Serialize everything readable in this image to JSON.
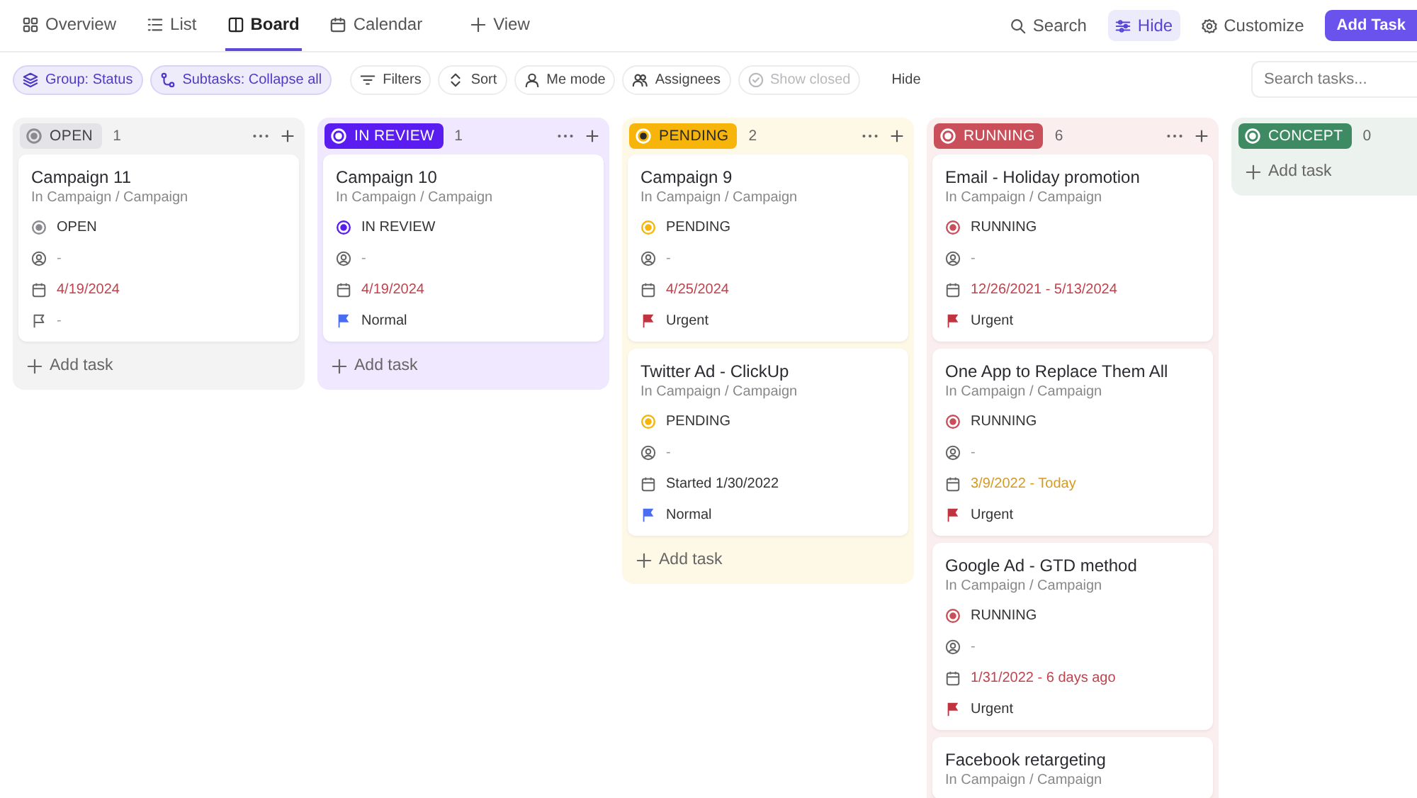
{
  "views": [
    {
      "label": "Overview",
      "selected": false
    },
    {
      "label": "List",
      "selected": false
    },
    {
      "label": "Board",
      "selected": true
    },
    {
      "label": "Calendar",
      "selected": false
    },
    {
      "label": "View",
      "selected": false
    }
  ],
  "header_actions": [
    {
      "label": "Search",
      "selected": false
    },
    {
      "label": "Hide",
      "selected": true
    },
    {
      "label": "Customize",
      "selected": false
    }
  ],
  "add_task_button": "Add Task",
  "toolbar": [
    {
      "label": "Group: Status",
      "kind": "chip",
      "disabled": false
    },
    {
      "label": "Subtasks: Collapse all",
      "kind": "chip",
      "disabled": false
    },
    {
      "label": "Filters",
      "kind": "plain",
      "disabled": false
    },
    {
      "label": "Sort",
      "kind": "plain",
      "disabled": false
    },
    {
      "label": "Me mode",
      "kind": "plain",
      "disabled": false
    },
    {
      "label": "Assignees",
      "kind": "plain",
      "disabled": false
    },
    {
      "label": "Show closed",
      "kind": "plain",
      "disabled": true
    },
    {
      "label": "Hide",
      "kind": "text",
      "disabled": false
    }
  ],
  "search": {
    "placeholder": "Search tasks..."
  },
  "columns": [
    {
      "name": "OPEN",
      "count": "1",
      "color": "#8a8a8f",
      "kind": "light",
      "add_task": "Add task",
      "tasks": [
        {
          "title": "Campaign 11",
          "location": "In Campaign / Campaign",
          "status": "OPEN",
          "assignee": "-",
          "date": {
            "text": "4/19/2024",
            "color": "#c0434d"
          },
          "priority": {
            "label": "-"
          }
        }
      ]
    },
    {
      "name": "IN REVIEW",
      "count": "1",
      "color": "#5b1cf0",
      "kind": "solid",
      "add_task": "Add task",
      "tasks": [
        {
          "title": "Campaign 10",
          "location": "In Campaign / Campaign",
          "status": "IN REVIEW",
          "assignee": "-",
          "date": {
            "text": "4/19/2024",
            "color": "#c0434d"
          },
          "priority": {
            "label": "Normal",
            "color": "#4a6cf0"
          }
        }
      ]
    },
    {
      "name": "PENDING",
      "count": "2",
      "color": "#f7b50c",
      "kind": "solid",
      "add_task": "Add task",
      "tasks": [
        {
          "title": "Campaign 9",
          "location": "In Campaign / Campaign",
          "status": "PENDING",
          "assignee": "-",
          "date": {
            "text": "4/25/2024",
            "color": "#c0434d"
          },
          "priority": {
            "label": "Urgent",
            "color": "#c0343f"
          }
        },
        {
          "title": "Twitter Ad - ClickUp",
          "location": "In Campaign / Campaign",
          "status": "PENDING",
          "assignee": "-",
          "date": {
            "text": "Started 1/30/2022"
          },
          "priority": {
            "label": "Normal",
            "color": "#4a6cf0"
          }
        }
      ]
    },
    {
      "name": "RUNNING",
      "count": "6",
      "color": "#c9505a",
      "kind": "solid",
      "tasks": [
        {
          "title": "Email - Holiday promotion",
          "location": "In Campaign / Campaign",
          "status": "RUNNING",
          "assignee": "-",
          "date": {
            "text": "12/26/2021 - 5/13/2024",
            "color": "#c0434d"
          },
          "priority": {
            "label": "Urgent",
            "color": "#c0343f"
          }
        },
        {
          "title": "One App to Replace Them All",
          "location": "In Campaign / Campaign",
          "status": "RUNNING",
          "assignee": "-",
          "date": {
            "text": "3/9/2022 - Today",
            "color": "#d69a20"
          },
          "priority": {
            "label": "Urgent",
            "color": "#c0343f"
          }
        },
        {
          "title": "Google Ad - GTD method",
          "location": "In Campaign / Campaign",
          "status": "RUNNING",
          "assignee": "-",
          "date": {
            "text": "1/31/2022 - 6 days ago",
            "color": "#c0434d"
          },
          "priority": {
            "label": "Urgent",
            "color": "#c0343f"
          }
        },
        {
          "title": "Facebook retargeting",
          "location": "In Campaign / Campaign"
        }
      ]
    },
    {
      "name": "CONCEPT",
      "count": "0",
      "color": "#3e8a62",
      "kind": "solid",
      "add_task": "Add task"
    }
  ]
}
